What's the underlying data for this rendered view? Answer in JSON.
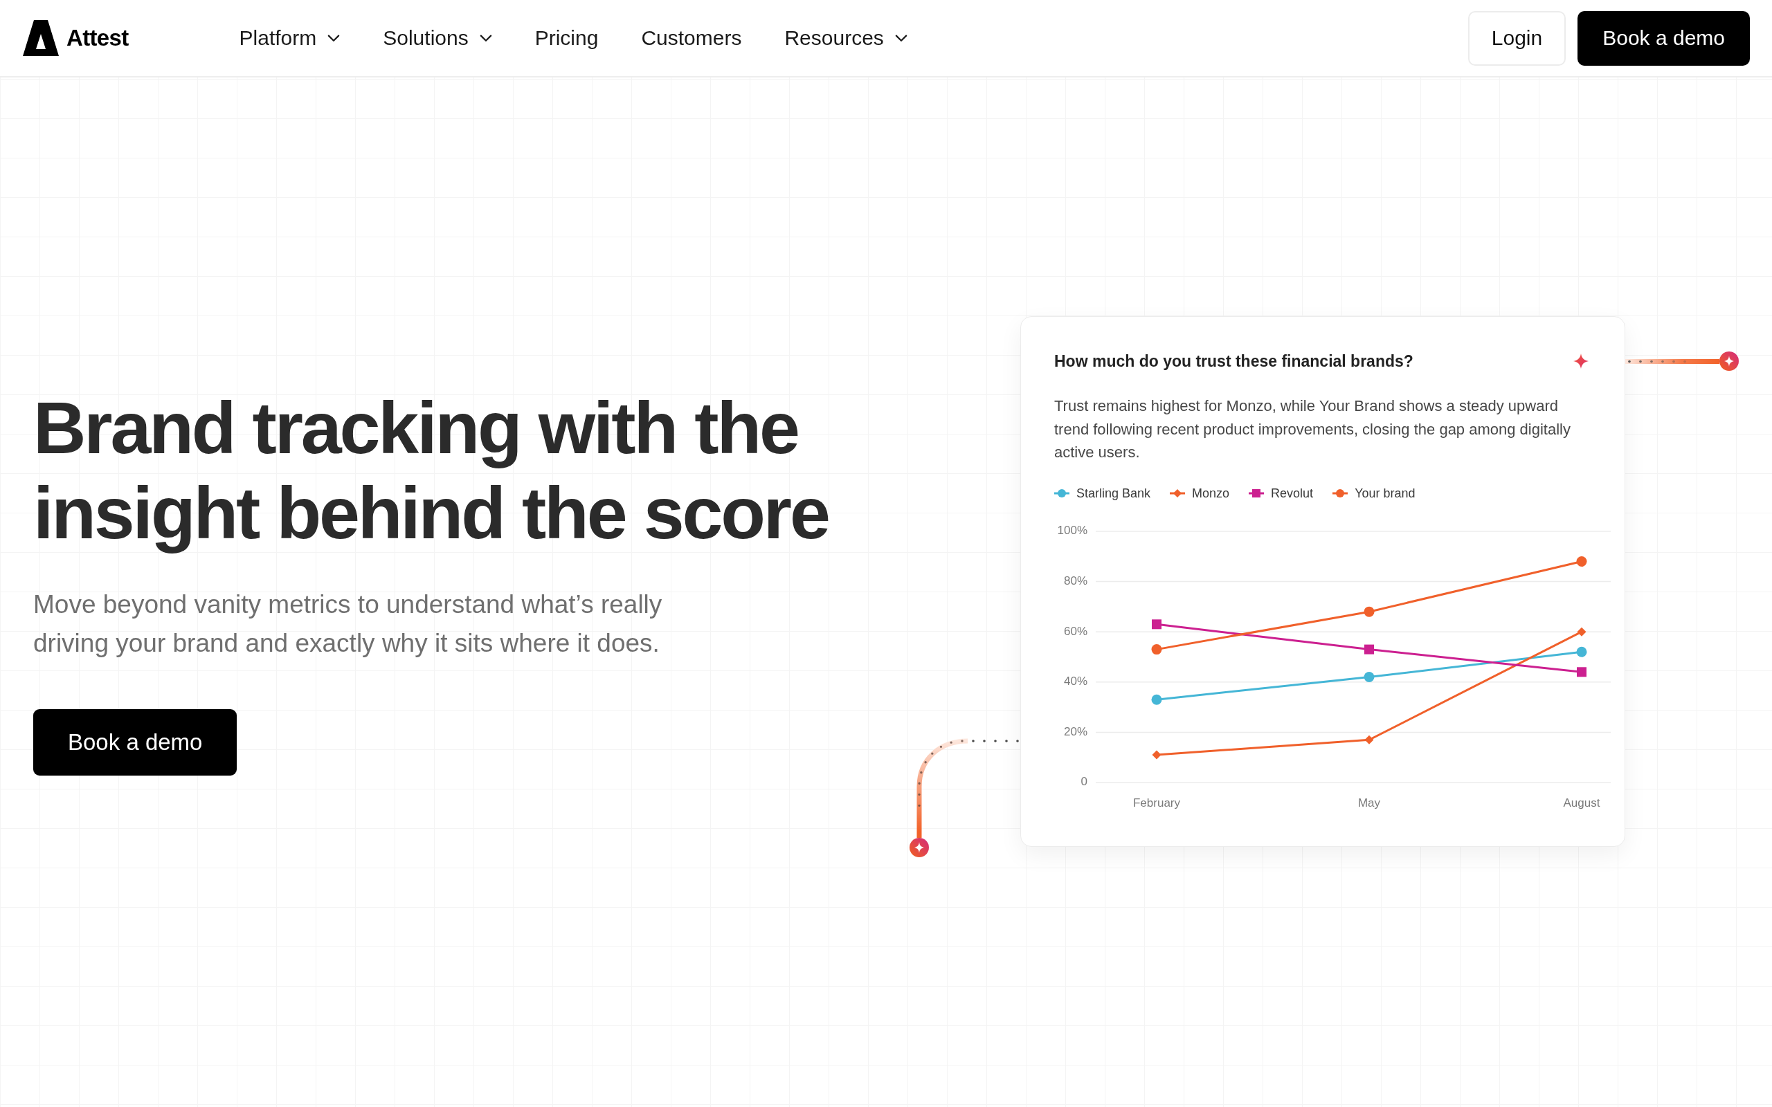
{
  "nav": {
    "logo": "Attest",
    "items": [
      {
        "label": "Platform",
        "has_menu": true
      },
      {
        "label": "Solutions",
        "has_menu": true
      },
      {
        "label": "Pricing",
        "has_menu": false
      },
      {
        "label": "Customers",
        "has_menu": false
      },
      {
        "label": "Resources",
        "has_menu": true
      }
    ],
    "buttons": [
      {
        "label": "Login",
        "kind": "secondary"
      },
      {
        "label": "Book a demo",
        "kind": "primary"
      }
    ]
  },
  "hero": {
    "headline": "Brand tracking with the insight behind the score",
    "subtitle": "Move beyond vanity metrics to understand what’s really driving your brand and exactly why it sits where it does.",
    "button": "Book a demo"
  },
  "insight_card": {
    "question": "How much do you trust these financial brands?",
    "summary": "Trust remains highest for Monzo, while Your Brand shows a steady upward trend following recent product improvements, closing the gap among digitally active users.",
    "chart_data": {
      "type": "line",
      "categories": [
        "February",
        "May",
        "August"
      ],
      "series": [
        {
          "name": "Starling Bank",
          "color": "#45b6d6",
          "marker": "circle",
          "values": [
            33,
            42,
            52
          ]
        },
        {
          "name": "Monzo",
          "color": "#f0602b",
          "marker": "diamond",
          "values": [
            11,
            17,
            60
          ]
        },
        {
          "name": "Revolut",
          "color": "#cc2090",
          "marker": "square",
          "values": [
            63,
            53,
            44
          ]
        },
        {
          "name": "Your brand",
          "color": "#f0602b",
          "marker": "circle",
          "values": [
            53,
            68,
            88
          ]
        }
      ],
      "ylim": [
        0,
        100
      ],
      "yticks": [
        {
          "value": 0,
          "label": "0"
        },
        {
          "value": 20,
          "label": "20%"
        },
        {
          "value": 40,
          "label": "40%"
        },
        {
          "value": 60,
          "label": "60%"
        },
        {
          "value": 80,
          "label": "80%"
        },
        {
          "value": 100,
          "label": "100%"
        }
      ],
      "grid": true
    }
  }
}
